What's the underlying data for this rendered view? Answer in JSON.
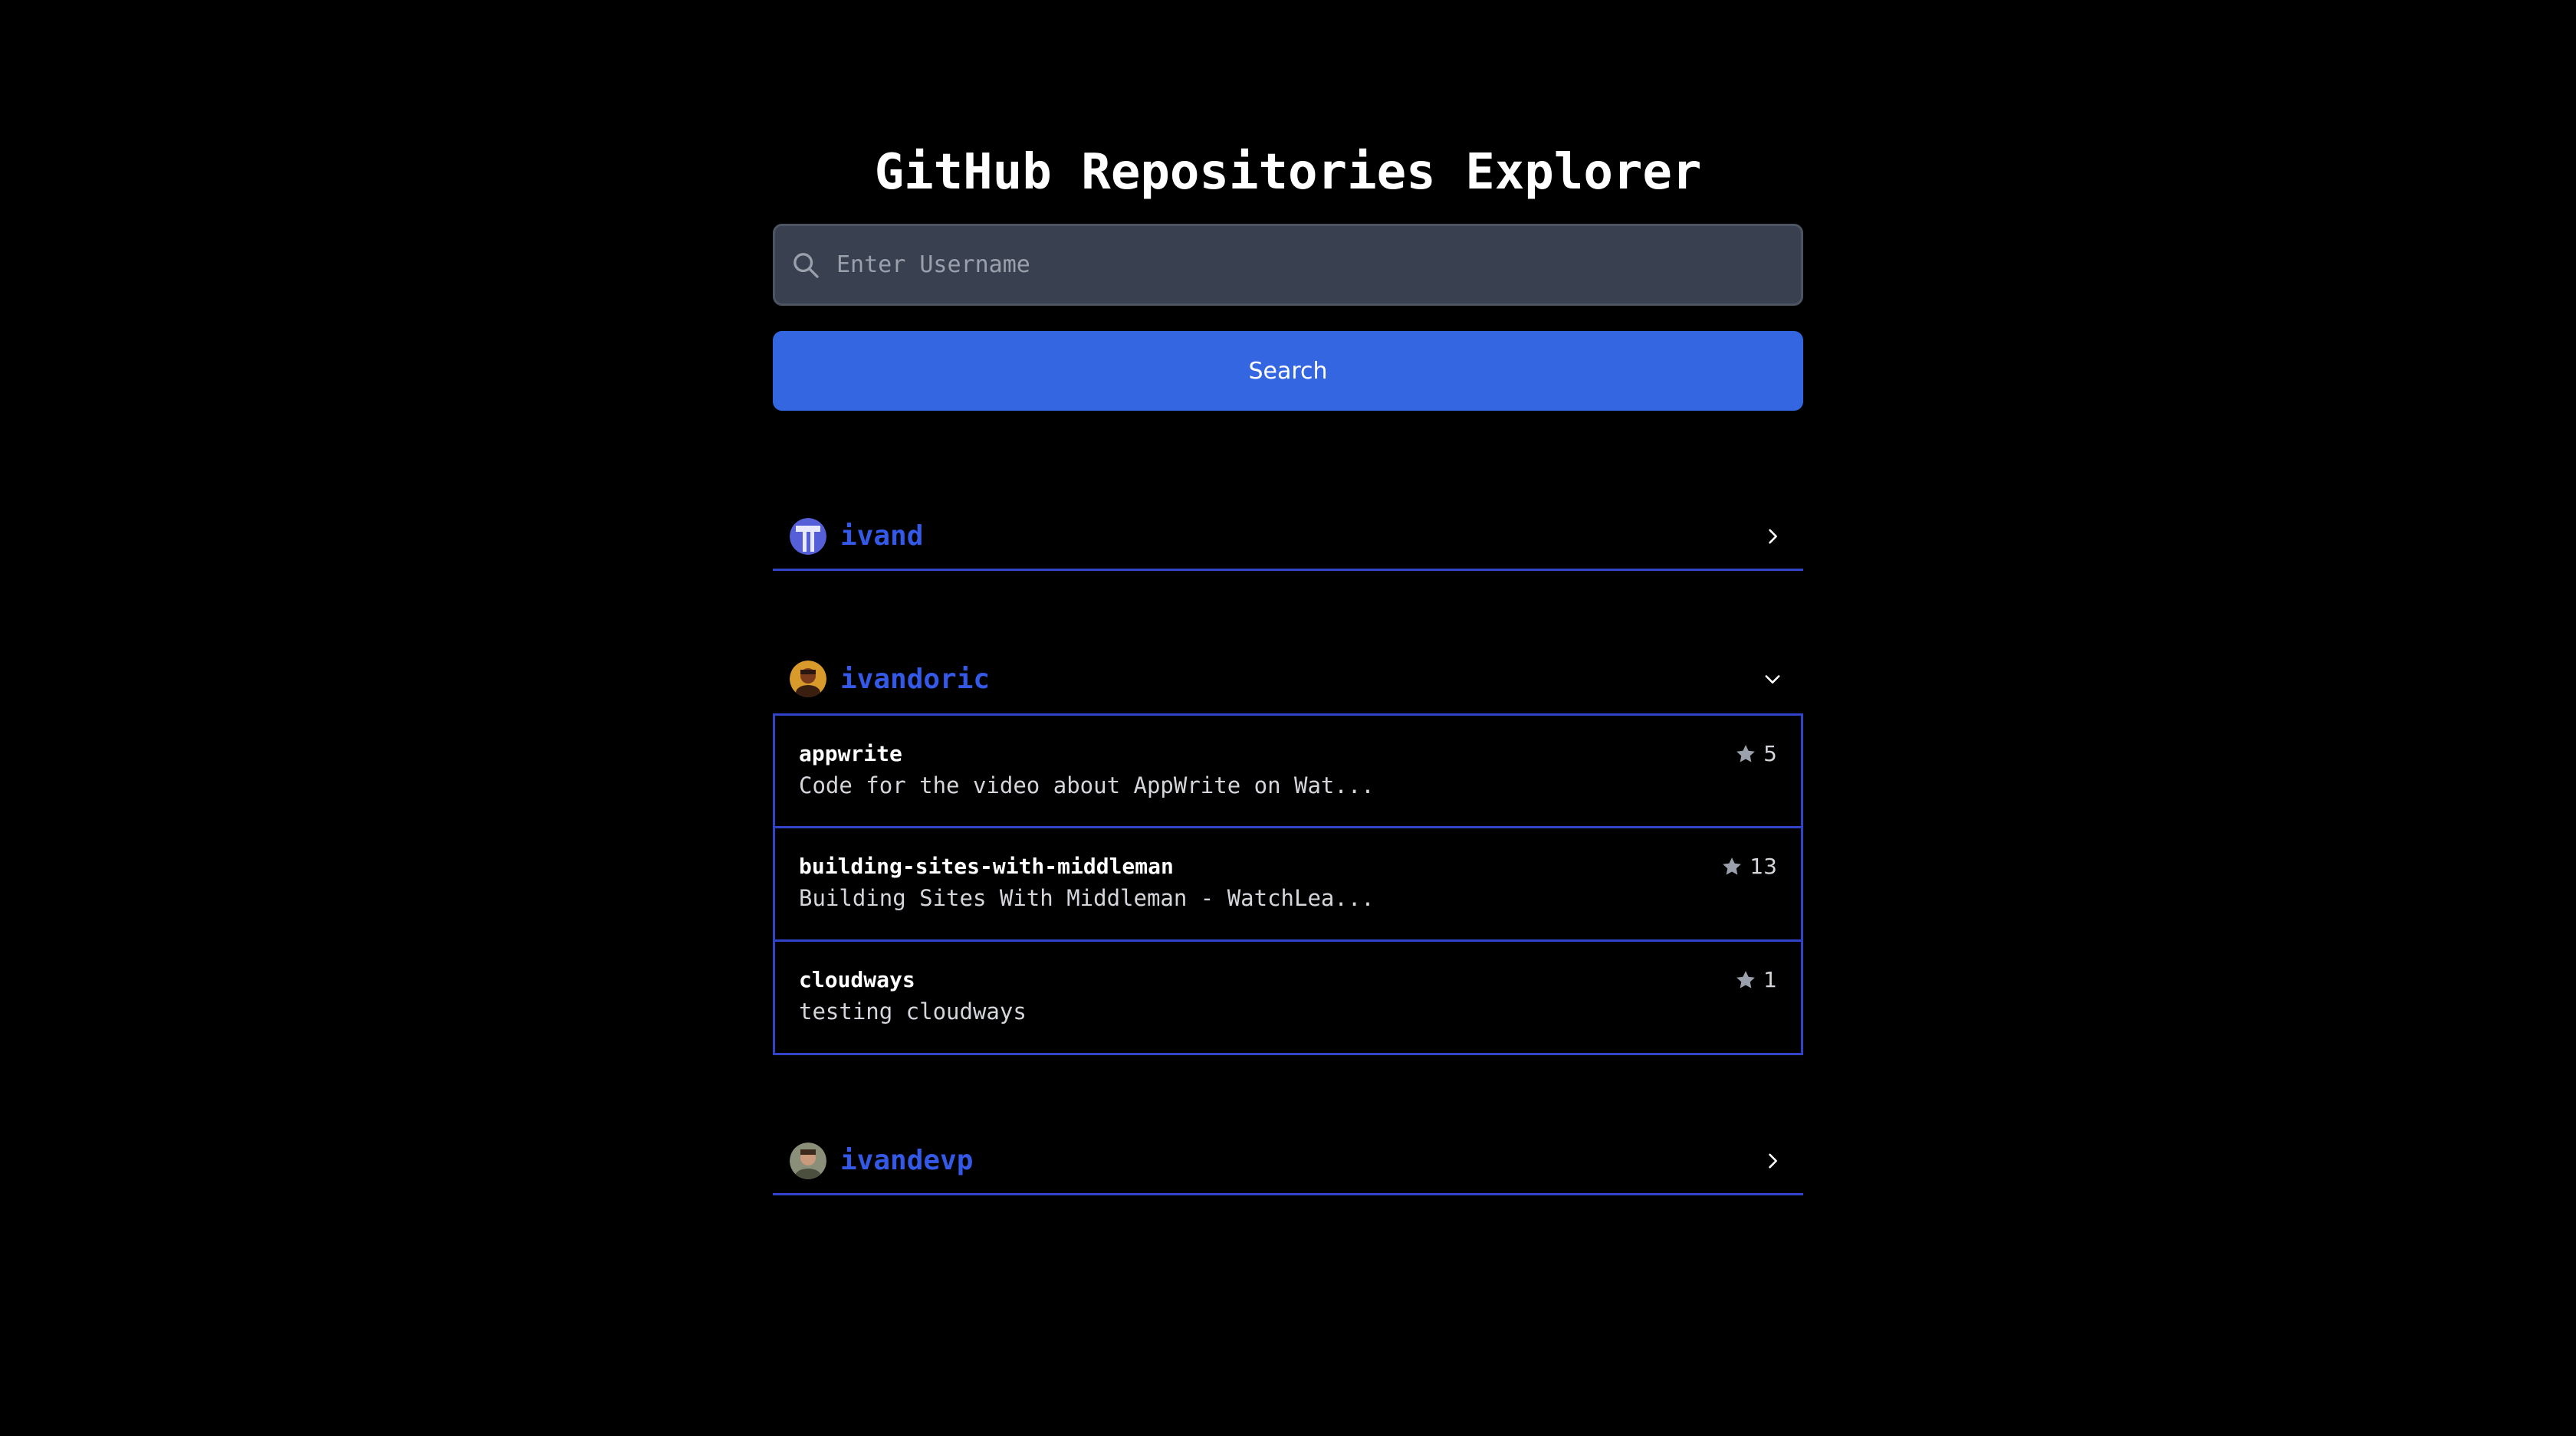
{
  "app": {
    "title": "GitHub Repositories Explorer"
  },
  "search": {
    "placeholder": "Enter Username",
    "value": "",
    "button_label": "Search"
  },
  "users": [
    {
      "username": "ivand",
      "expanded": false,
      "repos": []
    },
    {
      "username": "ivandoric",
      "expanded": true,
      "repos": [
        {
          "name": "appwrite",
          "description": "Code for the video about AppWrite on Wat...",
          "stars": "5"
        },
        {
          "name": "building-sites-with-middleman",
          "description": "Building Sites With Middleman - WatchLea...",
          "stars": "13"
        },
        {
          "name": "cloudways",
          "description": "testing cloudways",
          "stars": "1"
        }
      ]
    },
    {
      "username": "ivandevp",
      "expanded": false,
      "repos": []
    }
  ],
  "colors": {
    "background": "#000000",
    "accent": "#3366e0",
    "username": "#3459e6",
    "border": "#2f44c8",
    "input_bg": "#394150"
  },
  "icons": {
    "search": "search-icon",
    "star": "star-icon",
    "collapsed": "chevron-right-icon",
    "expanded": "chevron-down-icon"
  }
}
